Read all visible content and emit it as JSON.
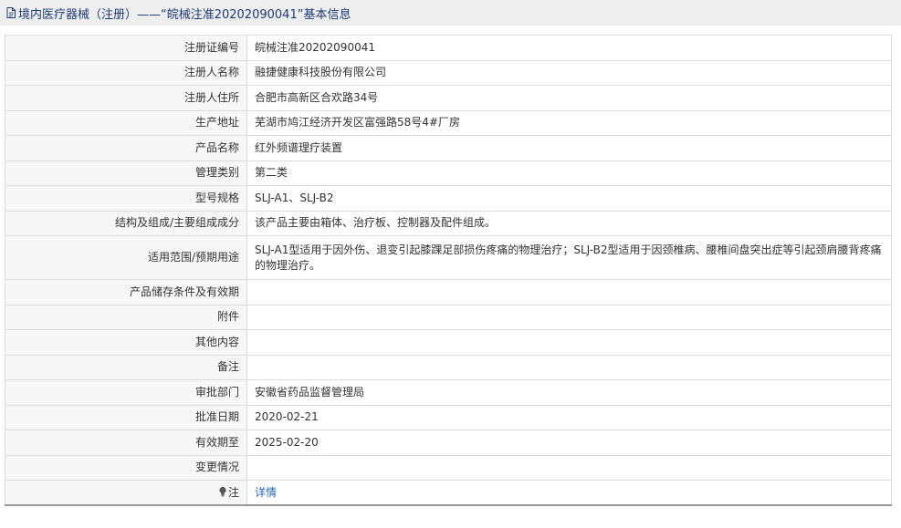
{
  "page_title": "境内医疗器械（注册）——“皖械注准20202090041”基本信息",
  "rows": [
    {
      "label": "注册证编号",
      "value": "皖械注准20202090041"
    },
    {
      "label": "注册人名称",
      "value": "融捷健康科技股份有限公司"
    },
    {
      "label": "注册人住所",
      "value": "合肥市高新区合欢路34号"
    },
    {
      "label": "生产地址",
      "value": "芜湖市鸠江经济开发区富强路58号4#厂房"
    },
    {
      "label": "产品名称",
      "value": "红外频谱理疗装置"
    },
    {
      "label": "管理类别",
      "value": "第二类"
    },
    {
      "label": "型号规格",
      "value": "SLJ-A1、SLJ-B2"
    },
    {
      "label": "结构及组成/主要组成成分",
      "value": "该产品主要由箱体、治疗板、控制器及配件组成。"
    },
    {
      "label": "适用范围/预期用途",
      "value": "SLJ-A1型适用于因外伤、退变引起膝踝足部损伤疼痛的物理治疗；SLJ-B2型适用于因颈椎病、腰椎间盘突出症等引起颈肩腰背疼痛的物理治疗。"
    },
    {
      "label": "产品储存条件及有效期",
      "value": ""
    },
    {
      "label": "附件",
      "value": ""
    },
    {
      "label": "其他内容",
      "value": ""
    },
    {
      "label": "备注",
      "value": ""
    },
    {
      "label": "审批部门",
      "value": "安徽省药品监督管理局"
    },
    {
      "label": "批准日期",
      "value": "2020-02-21"
    },
    {
      "label": "有效期至",
      "value": "2025-02-20"
    },
    {
      "label": "变更情况",
      "value": ""
    }
  ],
  "note_row": {
    "label": "注",
    "link_text": "详情",
    "icon": "lightbulb-icon"
  },
  "colors": {
    "title_text": "#1a3a7a",
    "link": "#2a66c8",
    "label_bg": "#f7f7f7",
    "border": "#dcdcdc"
  }
}
